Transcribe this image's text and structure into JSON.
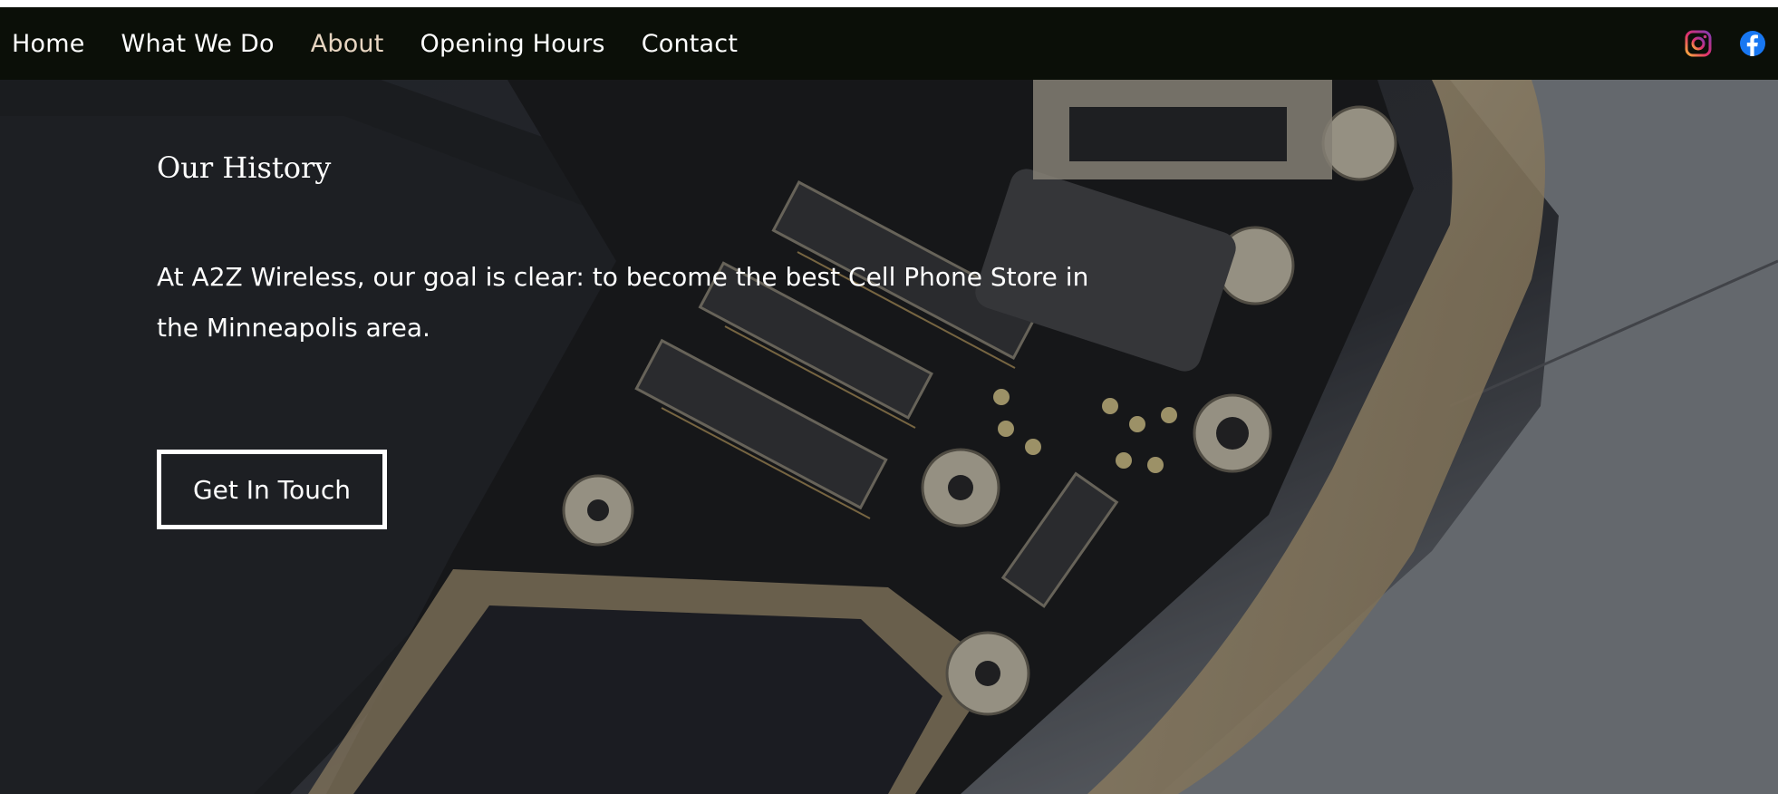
{
  "nav": {
    "items": [
      {
        "label": "Home"
      },
      {
        "label": "What We Do"
      },
      {
        "label": "About"
      },
      {
        "label": "Opening Hours"
      },
      {
        "label": "Contact"
      }
    ],
    "active_item": "About",
    "social_icons": [
      "instagram-icon",
      "facebook-icon"
    ]
  },
  "hero": {
    "title": "Our History",
    "text": "At A2Z Wireless, our goal is clear: to become the best Cell Phone Store in the Minneapolis area.",
    "cta_label": "Get In Touch"
  },
  "colors": {
    "navbar_bg": "#0b0f08",
    "active_nav": "#e7d5c1",
    "text": "#ffffff",
    "facebook": "#1877f2",
    "phone_gold": "#c9b38d"
  }
}
